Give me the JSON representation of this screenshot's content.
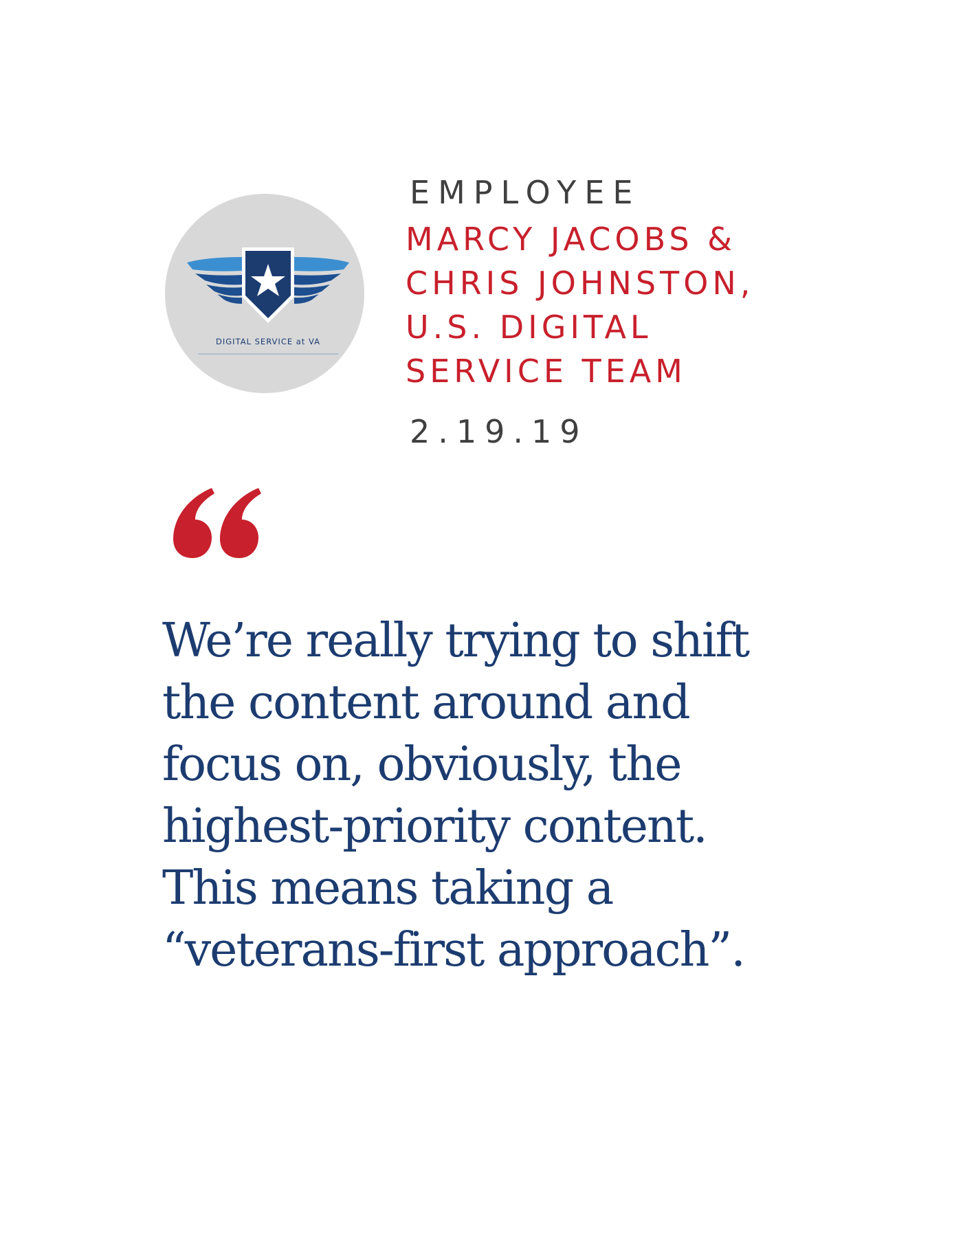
{
  "logo": {
    "caption": "DIGITAL SERVICE at VA",
    "icon": "winged-shield-star-icon",
    "colors": {
      "circle": "#d8d8d9",
      "wing_light": "#3b8fd0",
      "wing_dark": "#1d4e8f",
      "shield": "#1c3c70",
      "star": "#ffffff"
    }
  },
  "header": {
    "label": "EMPLOYEE",
    "name_lines": [
      "MARCY JACOBS &",
      "CHRIS JOHNSTON,",
      "U.S. DIGITAL",
      "SERVICE TEAM"
    ],
    "date": "2.19.19"
  },
  "quote": {
    "icon": "open-quote-icon",
    "lines": [
      "We’re really trying to shift",
      "the content around and",
      "focus on, obviously, the",
      "highest-priority content.",
      "This means taking a",
      "“veterans-first approach”."
    ]
  },
  "colors": {
    "accent_red": "#c8202c",
    "quote_blue": "#1c3c70",
    "label_gray": "#3f3f3f"
  }
}
